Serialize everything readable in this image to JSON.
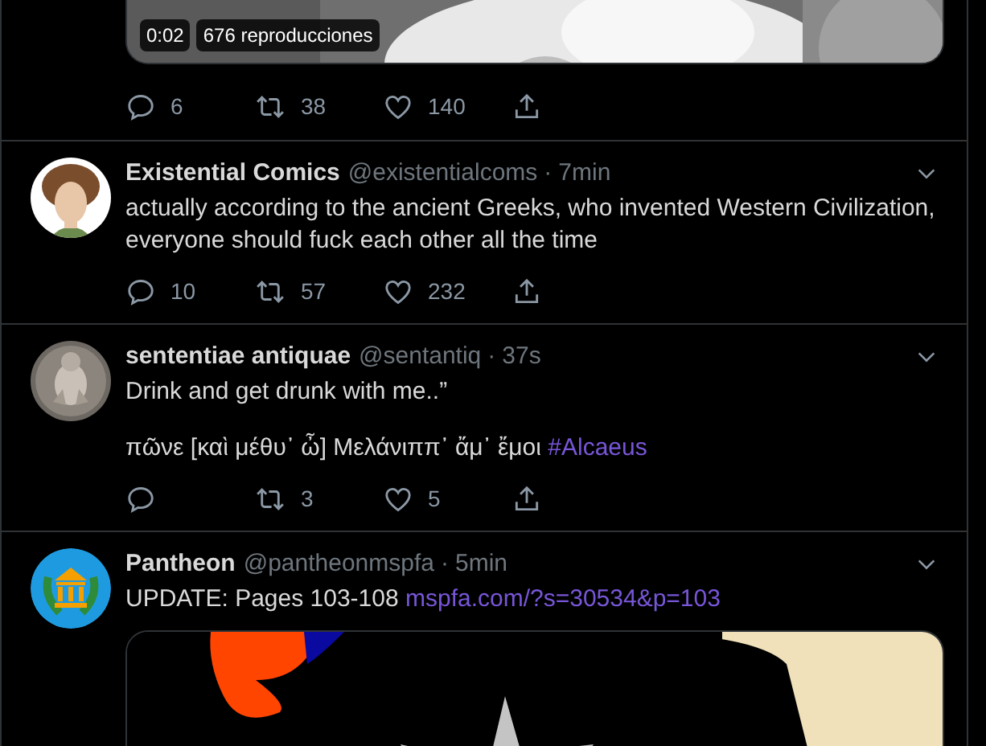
{
  "tweets": [
    {
      "media": {
        "kind": "video",
        "duration": "0:02",
        "views": "676 reproducciones"
      },
      "actions": [
        {
          "kind": "reply",
          "count": "6"
        },
        {
          "kind": "retweet",
          "count": "38"
        },
        {
          "kind": "like",
          "count": "140"
        },
        {
          "kind": "share"
        }
      ]
    },
    {
      "avatar": {
        "kind": "picture"
      },
      "name": "Existential Comics",
      "handle": "@existentialcoms",
      "separator": "·",
      "time": "7min",
      "paragraphs": [
        [
          {
            "kind": "text",
            "text": "actually according to the ancient Greeks, who invented Western Civilization, everyone should fuck each other all the time"
          }
        ]
      ],
      "actions": [
        {
          "kind": "reply",
          "count": "10"
        },
        {
          "kind": "retweet",
          "count": "57"
        },
        {
          "kind": "like",
          "count": "232"
        },
        {
          "kind": "share"
        }
      ]
    },
    {
      "avatar": {
        "kind": "picture"
      },
      "name": "sententiae antiquae",
      "handle": "@sentantiq",
      "separator": "·",
      "time": "37s",
      "paragraphs": [
        [
          {
            "kind": "text",
            "text": "Drink and get drunk with me..”"
          }
        ],
        [
          {
            "kind": "text",
            "text": "πῶνε [καὶ μέθυ᾽ ὦ] Μελάνιππ᾽ ἄμ᾽ ἔμοι"
          },
          {
            "kind": "hashtag",
            "text": "#Alcaeus"
          }
        ]
      ],
      "actions": [
        {
          "kind": "reply"
        },
        {
          "kind": "retweet",
          "count": "3"
        },
        {
          "kind": "like",
          "count": "5"
        },
        {
          "kind": "share"
        }
      ]
    },
    {
      "avatar": {
        "kind": "logo"
      },
      "name": "Pantheon",
      "handle": "@pantheonmspfa",
      "separator": "·",
      "time": "5min",
      "paragraphs": [
        [
          {
            "kind": "text",
            "text": "UPDATE: Pages 103-108"
          },
          {
            "kind": "link",
            "text": "mspfa.com/?s=30534&p=103"
          }
        ]
      ],
      "media": {
        "kind": "picture"
      }
    }
  ]
}
